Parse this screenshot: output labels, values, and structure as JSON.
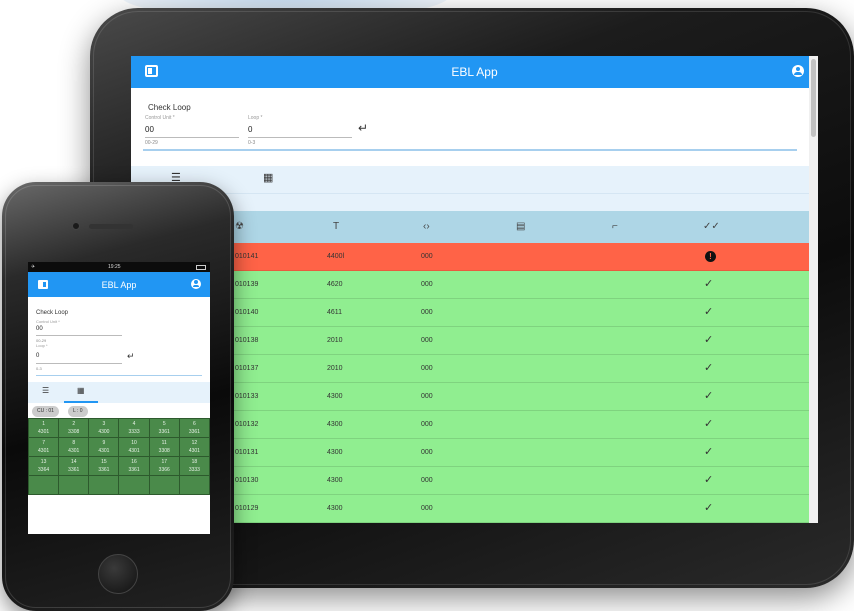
{
  "app_title": "EBL App",
  "form": {
    "title": "Check Loop",
    "control_unit_label": "Control Unit *",
    "control_unit_value": "00",
    "control_unit_hint": "00-29",
    "loop_label": "Loop *",
    "loop_value": "0",
    "loop_hint": "0-3",
    "enter_symbol": "↵"
  },
  "tabs": {
    "list_icon": "list-icon",
    "grid_icon": "grid-icon"
  },
  "table": {
    "columns": [
      "radiation-icon",
      "T",
      "code-icon",
      "ticket-icon",
      "link-icon",
      "double-check-icon"
    ],
    "rows": [
      {
        "id": "010141",
        "t": "4400l",
        "code": "000",
        "status": "error"
      },
      {
        "id": "010139",
        "t": "4620",
        "code": "000",
        "status": "ok"
      },
      {
        "id": "010140",
        "t": "4611",
        "code": "000",
        "status": "ok"
      },
      {
        "id": "010138",
        "t": "2010",
        "code": "000",
        "status": "ok"
      },
      {
        "id": "010137",
        "t": "2010",
        "code": "000",
        "status": "ok"
      },
      {
        "id": "010133",
        "t": "4300",
        "code": "000",
        "status": "ok"
      },
      {
        "id": "010132",
        "t": "4300",
        "code": "000",
        "status": "ok"
      },
      {
        "id": "010131",
        "t": "4300",
        "code": "000",
        "status": "ok"
      },
      {
        "id": "010130",
        "t": "4300",
        "code": "000",
        "status": "ok"
      },
      {
        "id": "010129",
        "t": "4300",
        "code": "000",
        "status": "ok"
      }
    ],
    "row_colors": {
      "error": "#ff6347",
      "ok": "#90ee90"
    }
  },
  "phone": {
    "status_time": "19:25",
    "chips": [
      "CU : 01",
      "L : 0"
    ],
    "grid": [
      {
        "n": "1",
        "v": "4301"
      },
      {
        "n": "2",
        "v": "3308"
      },
      {
        "n": "3",
        "v": "4300"
      },
      {
        "n": "4",
        "v": "3333"
      },
      {
        "n": "5",
        "v": "3361"
      },
      {
        "n": "6",
        "v": "3361"
      },
      {
        "n": "7",
        "v": "4301"
      },
      {
        "n": "8",
        "v": "4301"
      },
      {
        "n": "9",
        "v": "4301"
      },
      {
        "n": "10",
        "v": "4301"
      },
      {
        "n": "11",
        "v": "3308"
      },
      {
        "n": "12",
        "v": "4301"
      },
      {
        "n": "13",
        "v": "3364"
      },
      {
        "n": "14",
        "v": "3361"
      },
      {
        "n": "15",
        "v": "3361"
      },
      {
        "n": "16",
        "v": "3361"
      },
      {
        "n": "17",
        "v": "3366"
      },
      {
        "n": "18",
        "v": "3333"
      },
      {
        "n": "",
        "v": ""
      },
      {
        "n": "",
        "v": ""
      },
      {
        "n": "",
        "v": ""
      },
      {
        "n": "",
        "v": ""
      },
      {
        "n": "",
        "v": ""
      },
      {
        "n": "",
        "v": ""
      }
    ]
  },
  "colors": {
    "accent": "#2196f3",
    "header": "#aed6e6",
    "tab_bg": "#e6f2fb"
  }
}
